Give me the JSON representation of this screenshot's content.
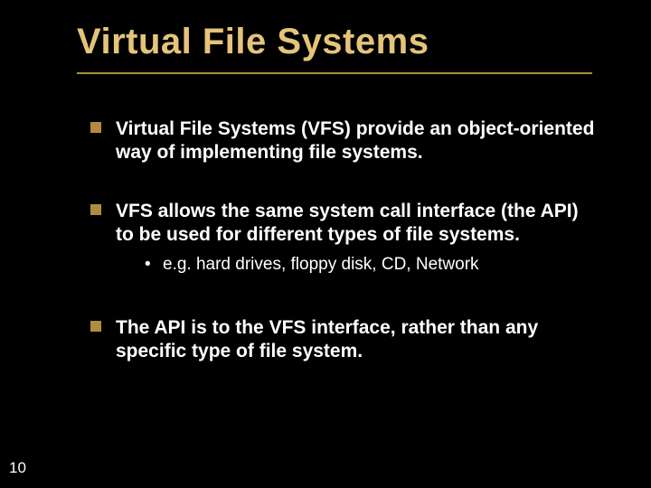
{
  "slide": {
    "title": "Virtual File Systems",
    "bullets": [
      {
        "text": "Virtual File Systems (VFS) provide an object-oriented way of implementing file systems.",
        "sub": []
      },
      {
        "text": "VFS allows the same system call interface (the API) to be used for different types of file systems.",
        "sub": [
          "e.g. hard drives, floppy disk, CD, Network"
        ]
      },
      {
        "text": "The API is to the VFS interface, rather than any specific type of file system.",
        "sub": []
      }
    ],
    "page_number": "10"
  }
}
